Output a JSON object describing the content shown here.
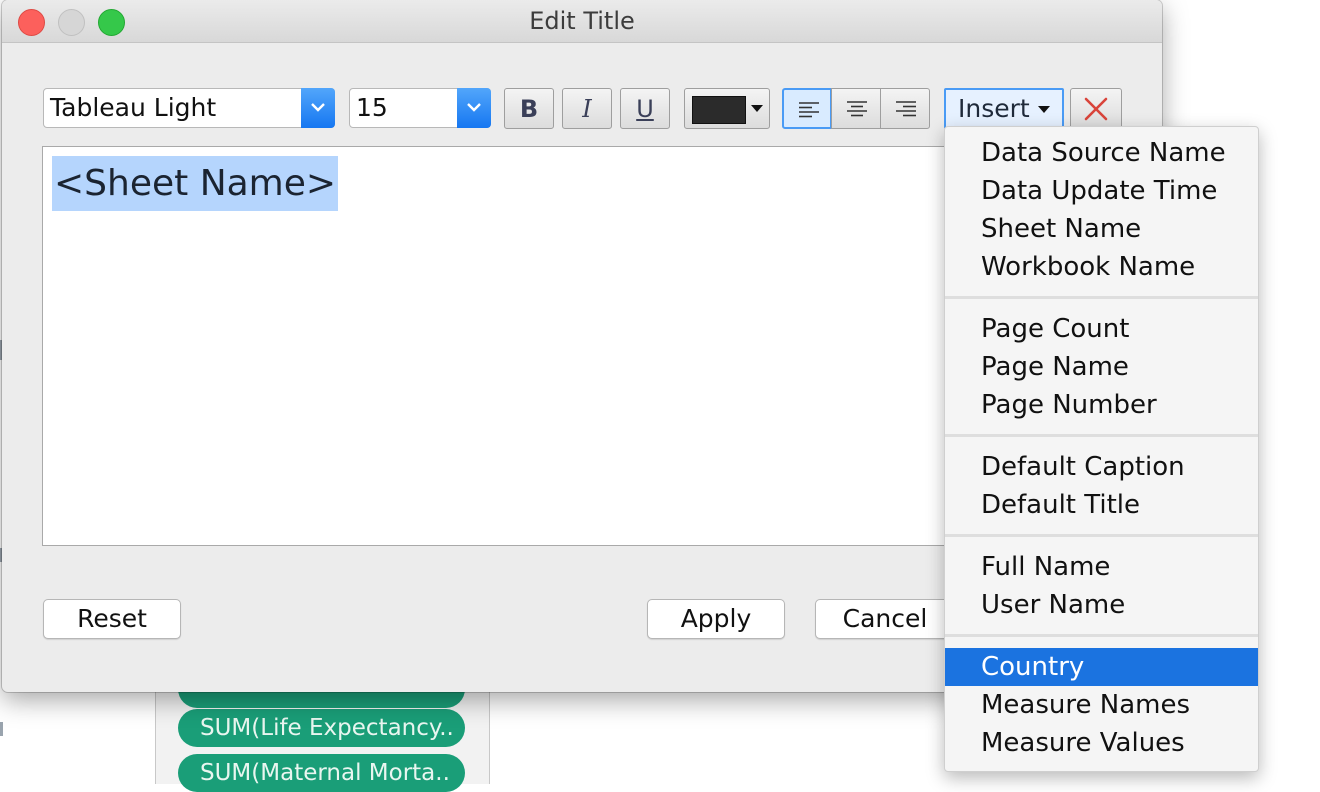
{
  "window": {
    "title": "Edit Title"
  },
  "toolbar": {
    "font_family": "Tableau Light",
    "font_size": "15",
    "bold_label": "B",
    "italic_label": "I",
    "underline_label": "U",
    "text_color": "#2b2b2b",
    "alignment_selected": "left",
    "insert_label": "Insert"
  },
  "editor": {
    "content": "<Sheet Name>"
  },
  "buttons": {
    "reset": "Reset",
    "apply": "Apply",
    "cancel": "Cancel"
  },
  "insert_menu": {
    "groups": [
      [
        "Data Source Name",
        "Data Update Time",
        "Sheet Name",
        "Workbook Name"
      ],
      [
        "Page Count",
        "Page Name",
        "Page Number"
      ],
      [
        "Default Caption",
        "Default Title"
      ],
      [
        "Full Name",
        "User Name"
      ],
      [
        "Country",
        "Measure Names",
        "Measure Values"
      ]
    ],
    "selected": "Country"
  },
  "background": {
    "pills": [
      "",
      "SUM(Life Expectancy..",
      "SUM(Maternal Morta.."
    ],
    "pill_color": "#1a9e78"
  },
  "colors": {
    "accent": "#1b73e0",
    "selection": "#b5d5fd"
  }
}
